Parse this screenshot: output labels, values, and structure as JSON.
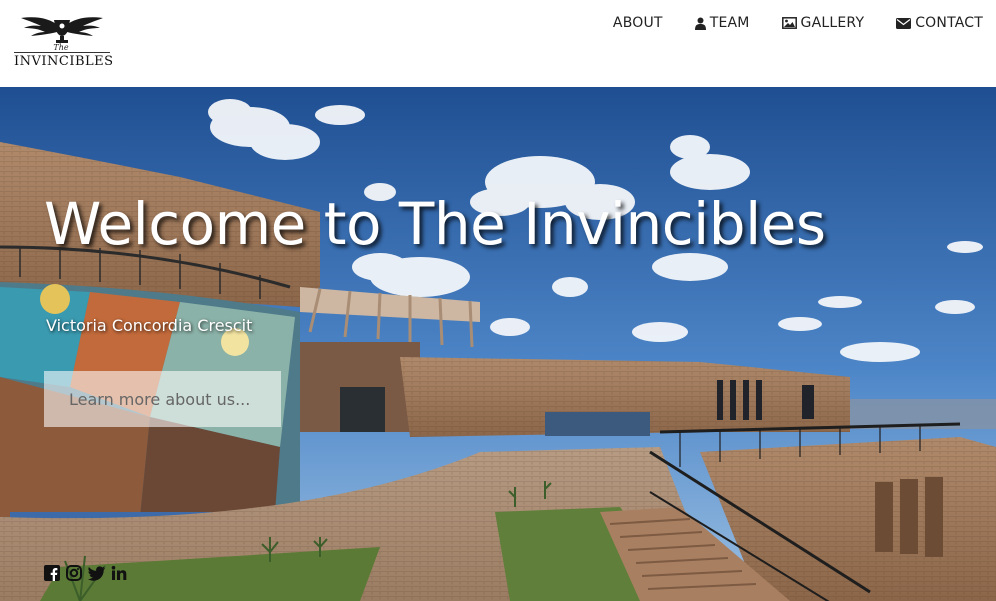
{
  "brand": {
    "small": "The",
    "name": "INVINCIBLES"
  },
  "nav": {
    "about": "ABOUT",
    "team": "TEAM",
    "gallery": "GALLERY",
    "contact": "CONTACT"
  },
  "hero": {
    "title": "Welcome to The Invincibles",
    "subtitle": "Victoria Concordia Crescit",
    "button": "Learn more about us..."
  },
  "social": [
    "facebook-icon",
    "instagram-icon",
    "twitter-icon",
    "linkedin-icon"
  ],
  "colors": {
    "nav_text": "#222222",
    "hero_text": "#ffffff",
    "button_bg": "#ffffff"
  }
}
